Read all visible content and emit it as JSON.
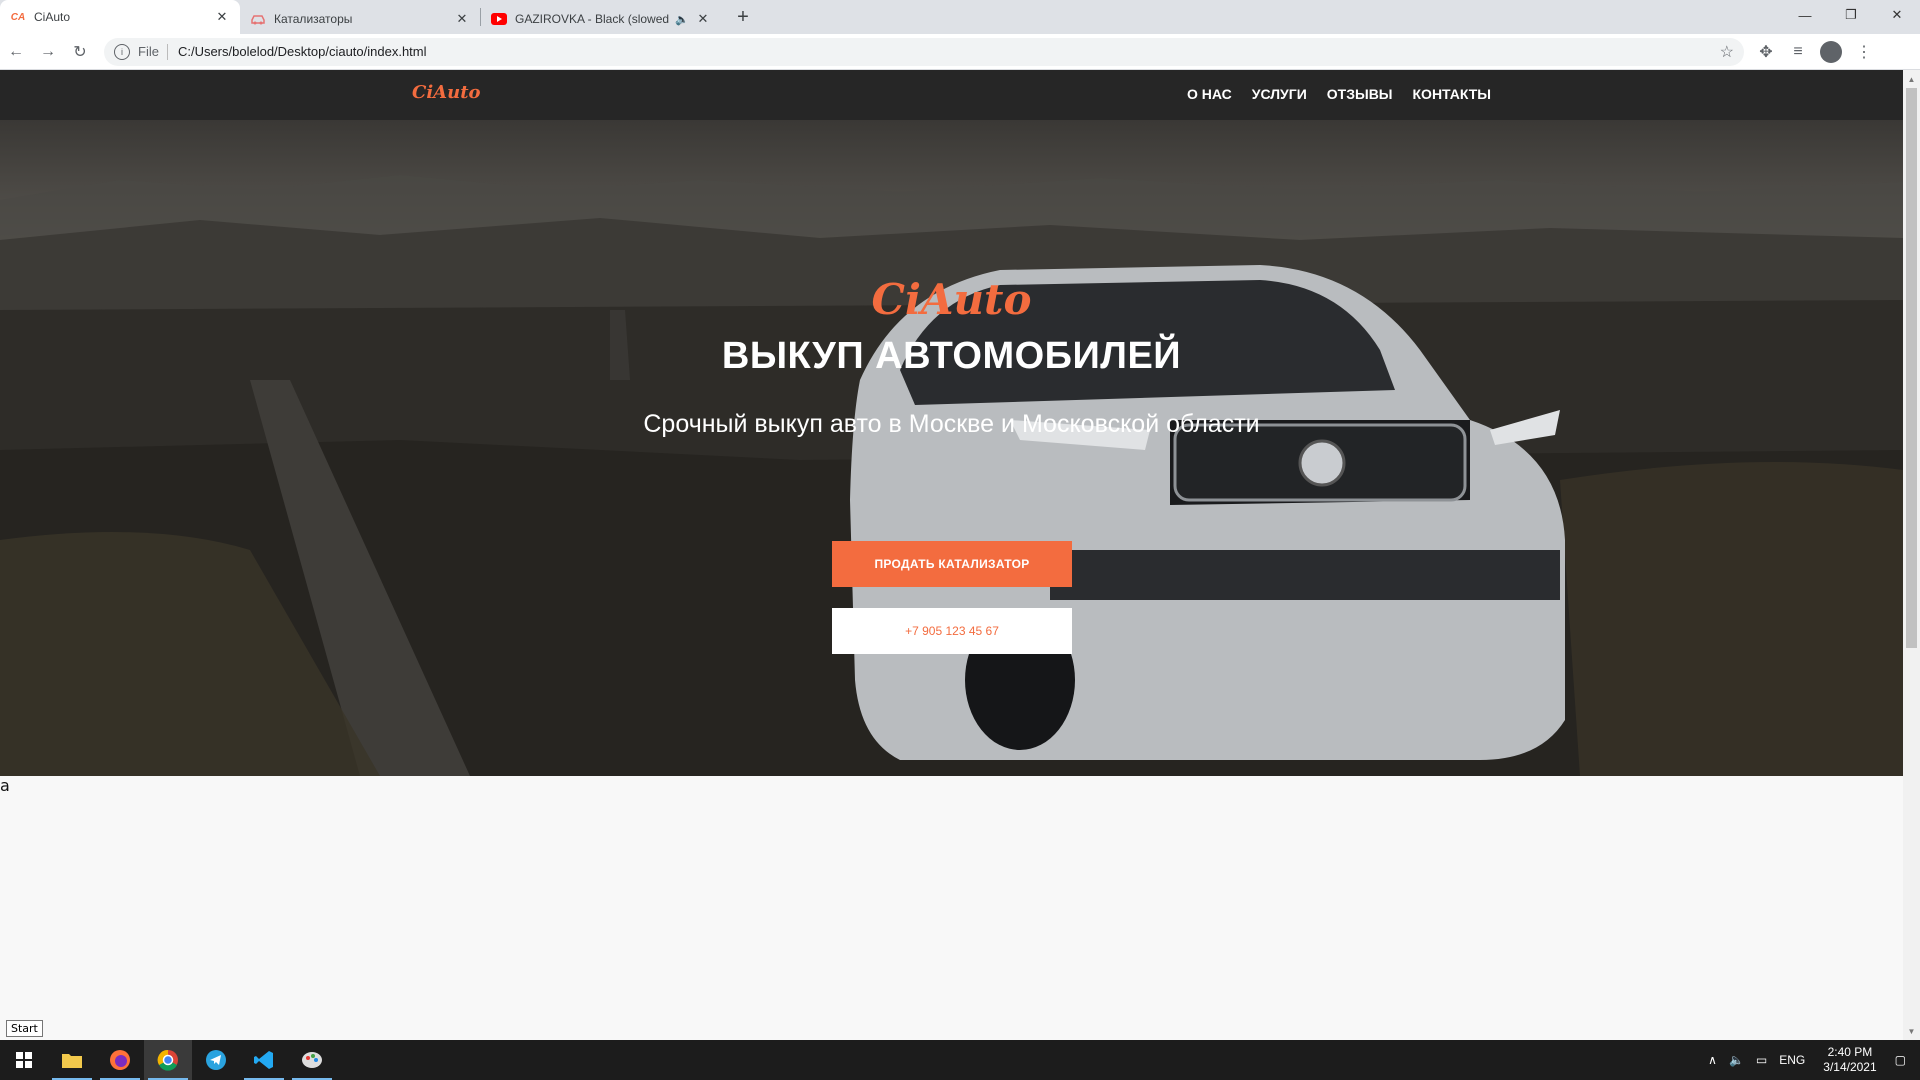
{
  "browser": {
    "tabs": [
      {
        "favicon": "CA",
        "title": "CiAuto",
        "active": true
      },
      {
        "favicon": "car-icon",
        "title": "Катализаторы",
        "active": false
      },
      {
        "favicon": "youtube-icon",
        "title": "GAZIROVKA - Black (slowed",
        "active": false
      }
    ],
    "address": {
      "scheme": "File",
      "url": "C:/Users/bolelod/Desktop/ciauto/index.html"
    }
  },
  "site": {
    "logo": "CiAuto",
    "menu": [
      "О НАС",
      "УСЛУГИ",
      "ОТЗЫВЫ",
      "КОНТАКТЫ"
    ],
    "hero": {
      "brand": "CiAuto",
      "title": "ВЫКУП АВТОМОБИЛЕЙ",
      "subtitle": "Срочный выкуп авто в Москве и Московской области",
      "primary_button": "ПРОДАТЬ КАТАЛИЗАТОР",
      "phone_button": "+7 905 123 45 67"
    },
    "stray_text": "a"
  },
  "os": {
    "tooltip": "Start",
    "tray": {
      "language": "ENG",
      "time": "2:40 PM",
      "date": "3/14/2021"
    }
  },
  "colors": {
    "accent": "#f36c3f",
    "nav_bg": "#262626"
  }
}
